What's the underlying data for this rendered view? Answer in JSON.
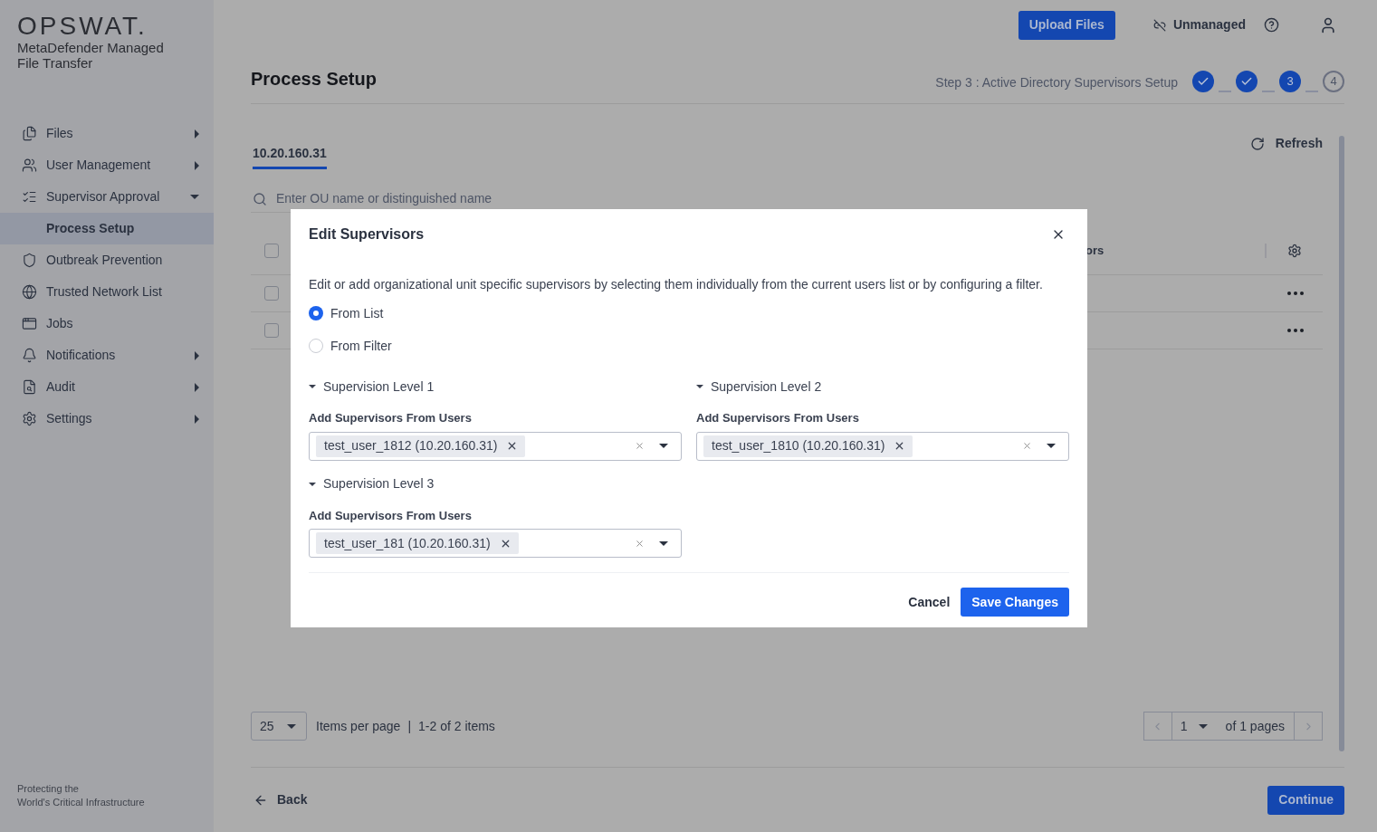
{
  "sidebar": {
    "logo": "OPSWAT.",
    "product": "MetaDefender Managed File Transfer",
    "items": [
      {
        "label": "Files",
        "kind": "files",
        "arrow": true,
        "expanded": false,
        "selected": false
      },
      {
        "label": "User Management",
        "kind": "users",
        "arrow": true,
        "expanded": false,
        "selected": false
      },
      {
        "label": "Supervisor Approval",
        "kind": "approval",
        "arrow": true,
        "expanded": true,
        "selected": false,
        "children": [
          {
            "label": "Process Setup",
            "selected": true
          }
        ]
      },
      {
        "label": "Outbreak Prevention",
        "kind": "shield",
        "arrow": false,
        "selected": false
      },
      {
        "label": "Trusted Network List",
        "kind": "globe",
        "arrow": false,
        "selected": false
      },
      {
        "label": "Jobs",
        "kind": "window",
        "arrow": false,
        "selected": false
      },
      {
        "label": "Notifications",
        "kind": "bell",
        "arrow": true,
        "expanded": false,
        "selected": false
      },
      {
        "label": "Audit",
        "kind": "audit",
        "arrow": true,
        "expanded": false,
        "selected": false
      },
      {
        "label": "Settings",
        "kind": "gear",
        "arrow": true,
        "expanded": false,
        "selected": false
      }
    ],
    "footer": [
      "Protecting the",
      "World's Critical Infrastructure"
    ]
  },
  "topbar": {
    "upload": "Upload Files",
    "status": "Unmanaged"
  },
  "page": {
    "title": "Process Setup",
    "step_label": "Step 3 : Active Directory Supervisors Setup",
    "steps": [
      {
        "kind": "done"
      },
      {
        "kind": "done"
      },
      {
        "kind": "current",
        "label": "3"
      },
      {
        "kind": "pending",
        "label": "4"
      }
    ]
  },
  "tabs": [
    {
      "label": "10.20.160.31",
      "selected": true
    }
  ],
  "refresh": "Refresh",
  "search": {
    "placeholder": "Enter OU name or distinguished name"
  },
  "table": {
    "column_partial": "ors",
    "rows": [
      {
        "checked": false
      },
      {
        "checked": false
      }
    ],
    "header_checked": false
  },
  "pagination": {
    "per_page": "25",
    "per_page_label": "Items per page",
    "separator": "|",
    "range": "1-2 of 2 items",
    "page": "1",
    "of_pages": "of 1 pages"
  },
  "footer": {
    "back": "Back",
    "continue": "Continue"
  },
  "modal": {
    "title": "Edit Supervisors",
    "description": "Edit or add organizational unit specific supervisors by selecting them individually from the current users list or by configuring a filter.",
    "options": [
      {
        "label": "From List",
        "selected": true
      },
      {
        "label": "From Filter",
        "selected": false
      }
    ],
    "levels": [
      {
        "title": "Supervision Level 1",
        "expanded": true,
        "field_label": "Add Supervisors From Users",
        "tags": [
          "test_user_1812 (10.20.160.31)"
        ]
      },
      {
        "title": "Supervision Level 2",
        "expanded": true,
        "field_label": "Add Supervisors From Users",
        "tags": [
          "test_user_1810 (10.20.160.31)"
        ]
      },
      {
        "title": "Supervision Level 3",
        "expanded": true,
        "field_label": "Add Supervisors From Users",
        "tags": [
          "test_user_181 (10.20.160.31)"
        ]
      }
    ],
    "cancel": "Cancel",
    "save": "Save Changes"
  }
}
